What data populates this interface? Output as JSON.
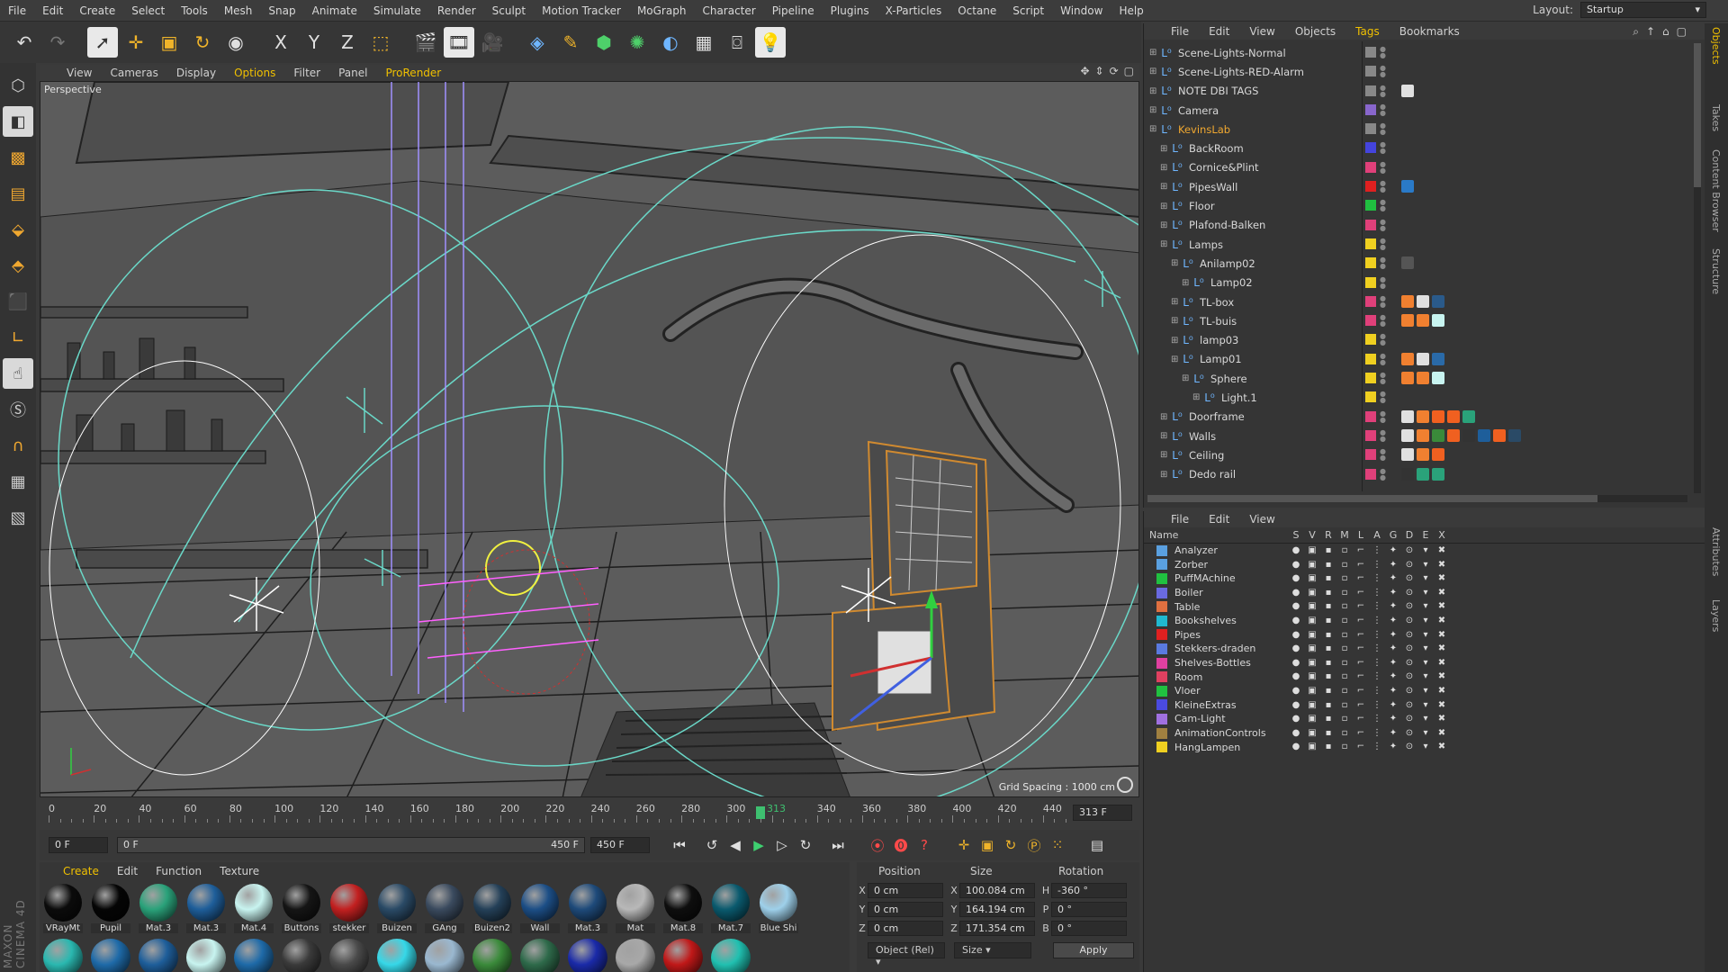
{
  "menubar": {
    "items": [
      "File",
      "Edit",
      "Create",
      "Select",
      "Tools",
      "Mesh",
      "Snap",
      "Animate",
      "Simulate",
      "Render",
      "Sculpt",
      "Motion Tracker",
      "MoGraph",
      "Character",
      "Pipeline",
      "Plugins",
      "X-Particles",
      "Octane",
      "Script",
      "Window",
      "Help"
    ],
    "layout_label": "Layout:",
    "layout_value": "Startup"
  },
  "toolbar": {
    "icons": [
      "undo-icon",
      "redo-icon",
      "live-selection-icon",
      "move-icon",
      "scale-icon",
      "rotate-icon",
      "recent-tool-icon",
      "x-axis-icon",
      "y-axis-icon",
      "z-axis-icon",
      "coordinate-system-icon",
      "render-view-icon",
      "render-picture-viewer-icon",
      "render-settings-icon",
      "cube-icon",
      "pen-icon",
      "subdivision-icon",
      "cloner-icon",
      "deformer-icon",
      "floor-icon",
      "camera-icon",
      "light-icon"
    ],
    "axis_x": "X",
    "axis_y": "Y",
    "axis_z": "Z"
  },
  "brand": {
    "text": "MAXON CINEMA 4D"
  },
  "viewport": {
    "menu": [
      "View",
      "Cameras",
      "Display",
      "Options",
      "Filter",
      "Panel",
      "ProRender"
    ],
    "label": "Perspective",
    "grid_spacing": "Grid Spacing : 1000 cm"
  },
  "timeline": {
    "ticks": [
      "0",
      "20",
      "40",
      "60",
      "80",
      "100",
      "120",
      "140",
      "160",
      "180",
      "200",
      "220",
      "240",
      "260",
      "280",
      "300",
      "313",
      "340",
      "360",
      "380",
      "400",
      "420",
      "440"
    ],
    "current_frame": 313,
    "max_frame": 450,
    "frame_field": "313 F"
  },
  "transport": {
    "start": "0 F",
    "slider_left": "0 F",
    "slider_right": "450 F",
    "end": "450 F"
  },
  "materials": {
    "menu": [
      "Create",
      "Edit",
      "Function",
      "Texture"
    ],
    "row1": [
      {
        "name": "VRayMt",
        "color": "#0b0b0b"
      },
      {
        "name": "Pupil",
        "color": "#050505"
      },
      {
        "name": "Mat.3",
        "color": "#2aa27a"
      },
      {
        "name": "Mat.3",
        "color": "#1e5e9a"
      },
      {
        "name": "Mat.4",
        "color": "#c8f4f0"
      },
      {
        "name": "Buttons",
        "color": "#151515"
      },
      {
        "name": "stekker",
        "color": "#c22020"
      },
      {
        "name": "Buizen",
        "color": "#2a4a66"
      },
      {
        "name": "GAng",
        "color": "#3a4a5e"
      },
      {
        "name": "Buizen2",
        "color": "#244058"
      },
      {
        "name": "Wall",
        "color": "#1c4e86"
      },
      {
        "name": "Mat.3",
        "color": "#1e4a7a"
      },
      {
        "name": "Mat",
        "color": "#b8b8b8"
      },
      {
        "name": "Mat.8",
        "color": "#0e0e0e"
      },
      {
        "name": "Mat.7",
        "color": "#0a5a6e"
      },
      {
        "name": "Blue Shi",
        "color": "#9ed0ea"
      }
    ],
    "row2": [
      "#2ab8b0",
      "#1e6aa8",
      "#1e5e9a",
      "#c8f4f0",
      "#1e6aa8",
      "#3a3a3a",
      "#4a4a4a",
      "#36d8e8",
      "#9ab8d0",
      "#3a8a3a",
      "#2e6a4a",
      "#1a2aa8",
      "#a8a8a8",
      "#c01818",
      "#20c0b0"
    ]
  },
  "coordinates": {
    "headers": [
      "Position",
      "Size",
      "Rotation"
    ],
    "rows": [
      {
        "axis": "X",
        "pos": "0 cm",
        "size_axis": "X",
        "size": "100.084 cm",
        "rot_axis": "H",
        "rot": "-360 °"
      },
      {
        "axis": "Y",
        "pos": "0 cm",
        "size_axis": "Y",
        "size": "164.194 cm",
        "rot_axis": "P",
        "rot": "0 °"
      },
      {
        "axis": "Z",
        "pos": "0 cm",
        "size_axis": "Z",
        "size": "171.354 cm",
        "rot_axis": "B",
        "rot": "0 °"
      }
    ],
    "mode": "Object (Rel)",
    "size_mode": "Size",
    "apply": "Apply"
  },
  "object_manager": {
    "menu": [
      "File",
      "Edit",
      "View",
      "Objects",
      "Tags",
      "Bookmarks"
    ],
    "active_menu": "Tags",
    "objects": [
      {
        "name": "Scene-Lights-Normal",
        "indent": 0,
        "tag": "#888888",
        "tags": []
      },
      {
        "name": "Scene-Lights-RED-Alarm",
        "indent": 0,
        "tag": "#888888",
        "tags": []
      },
      {
        "name": "NOTE DBI TAGS",
        "indent": 0,
        "tag": "#888888",
        "tags": [
          "#e0e0e0"
        ]
      },
      {
        "name": "Camera",
        "indent": 0,
        "tag": "#8866cc",
        "tags": []
      },
      {
        "name": "KevinsLab",
        "indent": 0,
        "tag": "#888888",
        "tags": [],
        "highlight": true
      },
      {
        "name": "BackRoom",
        "indent": 1,
        "tag": "#4444dd",
        "tags": []
      },
      {
        "name": "Cornice&Plint",
        "indent": 1,
        "tag": "#e0407a",
        "tags": []
      },
      {
        "name": "PipesWall",
        "indent": 1,
        "tag": "#e02020",
        "tags": [
          "#2a7ac8"
        ]
      },
      {
        "name": "Floor",
        "indent": 1,
        "tag": "#20c040",
        "tags": []
      },
      {
        "name": "Plafond-Balken",
        "indent": 1,
        "tag": "#e0407a",
        "tags": []
      },
      {
        "name": "Lamps",
        "indent": 1,
        "tag": "#f0d020",
        "tags": []
      },
      {
        "name": "Anilamp02",
        "indent": 2,
        "tag": "#f0d020",
        "tags": [
          "#555555"
        ]
      },
      {
        "name": "Lamp02",
        "indent": 3,
        "tag": "#f0d020",
        "tags": []
      },
      {
        "name": "TL-box",
        "indent": 2,
        "tag": "#e0407a",
        "tags": [
          "#f08030",
          "#e0e0e0",
          "#2a5a8a"
        ]
      },
      {
        "name": "TL-buis",
        "indent": 2,
        "tag": "#e0407a",
        "tags": [
          "#f08030",
          "#f08030",
          "#c8f4f0"
        ]
      },
      {
        "name": "lamp03",
        "indent": 2,
        "tag": "#f0d020",
        "tags": []
      },
      {
        "name": "Lamp01",
        "indent": 2,
        "tag": "#f0d020",
        "tags": [
          "#f08030",
          "#e0e0e0",
          "#2a6aa8"
        ]
      },
      {
        "name": "Sphere",
        "indent": 3,
        "tag": "#f0d020",
        "tags": [
          "#f08030",
          "#f08030",
          "#c8f4f0"
        ]
      },
      {
        "name": "Light.1",
        "indent": 4,
        "tag": "#f0d020",
        "tags": []
      },
      {
        "name": "Doorframe",
        "indent": 1,
        "tag": "#e0407a",
        "tags": [
          "#e0e0e0",
          "#f08030",
          "#f06020",
          "#f06020",
          "#2aa27a"
        ]
      },
      {
        "name": "Walls",
        "indent": 1,
        "tag": "#e0407a",
        "tags": [
          "#e0e0e0",
          "#f08030",
          "#3a8a3a",
          "#f06020",
          "#333333",
          "#1e5e9a",
          "#f06020",
          "#2a4a66"
        ]
      },
      {
        "name": "Ceiling",
        "indent": 1,
        "tag": "#e0407a",
        "tags": [
          "#e0e0e0",
          "#f08030",
          "#f06020"
        ]
      },
      {
        "name": "Dedo rail",
        "indent": 1,
        "tag": "#e0407a",
        "tags": [
          "#333333",
          "#2aa27a",
          "#2aa27a"
        ]
      }
    ]
  },
  "layer_manager": {
    "menu": [
      "File",
      "Edit",
      "View"
    ],
    "columns": [
      "Name",
      "S",
      "V",
      "R",
      "M",
      "L",
      "A",
      "G",
      "D",
      "E",
      "X"
    ],
    "layers": [
      {
        "name": "Analyzer",
        "color": "#5aa0e0"
      },
      {
        "name": "Zorber",
        "color": "#5aa0e0"
      },
      {
        "name": "PuffMAchine",
        "color": "#20c040"
      },
      {
        "name": "Boiler",
        "color": "#6a6ae0"
      },
      {
        "name": "Table",
        "color": "#e07040"
      },
      {
        "name": "Bookshelves",
        "color": "#20b8d0"
      },
      {
        "name": "Pipes",
        "color": "#e02020"
      },
      {
        "name": "Stekkers-draden",
        "color": "#5a7ae0"
      },
      {
        "name": "Shelves-Bottles",
        "color": "#e040a0"
      },
      {
        "name": "Room",
        "color": "#e04060"
      },
      {
        "name": "Vloer",
        "color": "#20c040"
      },
      {
        "name": "KleineExtras",
        "color": "#4a4ae0"
      },
      {
        "name": "Cam-Light",
        "color": "#a070e0"
      },
      {
        "name": "AnimationControls",
        "color": "#a08040"
      },
      {
        "name": "HangLampen",
        "color": "#f0d020"
      }
    ]
  },
  "side_tabs": [
    "Objects",
    "Takes",
    "Content Browser",
    "Structure",
    "Attributes",
    "Layers"
  ],
  "colors": {
    "accent": "#f0c000",
    "highlight": "#f0a830",
    "timeline_cursor": "#3ec070"
  }
}
